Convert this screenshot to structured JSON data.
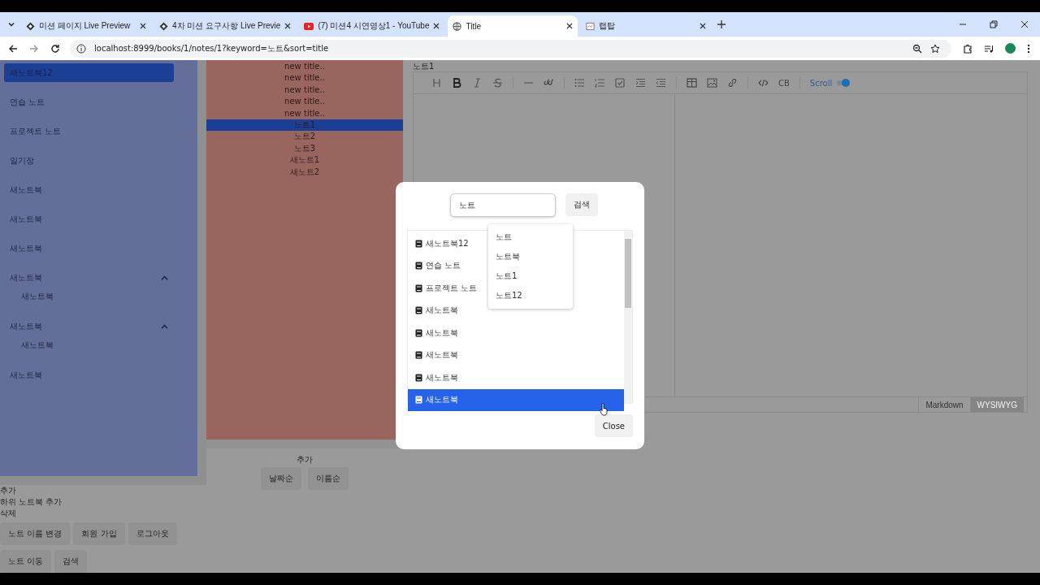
{
  "browser": {
    "tabs": [
      {
        "title": "미션 페이지 Live Preview",
        "selected": false
      },
      {
        "title": "4차 미션 요구사항 Live Previe",
        "selected": false
      },
      {
        "title": "(7) 미션4 시연영상1 - YouTube",
        "selected": false
      },
      {
        "title": "Title",
        "selected": true
      },
      {
        "title": "랩탑",
        "selected": false
      }
    ],
    "url": "localhost:8999/books/1/notes/1?keyword=노트&sort=title"
  },
  "sidebar": {
    "items": [
      {
        "label": "새노트북12",
        "selected": true
      },
      {
        "label": "연습 노트",
        "selected": false
      },
      {
        "label": "프로젝트 노트",
        "selected": false
      },
      {
        "label": "일기장",
        "selected": false
      },
      {
        "label": "새노트북",
        "selected": false
      },
      {
        "label": "새노트북",
        "selected": false
      },
      {
        "label": "새노트북",
        "selected": false
      },
      {
        "label": "새노트북",
        "selected": false,
        "expanded": true,
        "children": [
          {
            "label": "새노트북"
          }
        ]
      },
      {
        "label": "새노트북",
        "selected": false,
        "expanded": true,
        "children": [
          {
            "label": "새노트북"
          }
        ]
      },
      {
        "label": "새노트북",
        "selected": false
      }
    ],
    "links": [
      "추가",
      "하위 노트북 추가",
      "삭제"
    ],
    "buttons": [
      "노트 이름 변경",
      "회원 가입",
      "로그아웃",
      "노트 이동",
      "검색"
    ]
  },
  "notes": {
    "items": [
      {
        "title": "new title..",
        "selected": false
      },
      {
        "title": "new title..",
        "selected": false
      },
      {
        "title": "new title..",
        "selected": false
      },
      {
        "title": "new title..",
        "selected": false
      },
      {
        "title": "new title..",
        "selected": false
      },
      {
        "title": "노트1",
        "selected": true
      },
      {
        "title": "노트2",
        "selected": false
      },
      {
        "title": "노트3",
        "selected": false
      },
      {
        "title": "새노트1",
        "selected": false
      },
      {
        "title": "새노트2",
        "selected": false
      }
    ],
    "add": "추가",
    "sort_buttons": [
      "날짜순",
      "이름순"
    ]
  },
  "editor": {
    "title": "노트1",
    "codeblock": "CB",
    "scroll_label": "Scroll",
    "scroll_sync": true,
    "modes": [
      {
        "label": "Markdown",
        "selected": true
      },
      {
        "label": "WYSIWYG",
        "selected": false
      }
    ]
  },
  "dialog": {
    "search": {
      "value": "노트"
    },
    "search_button": "검색",
    "suggestions": [
      "노트",
      "노트북",
      "노트1",
      "노트12"
    ],
    "results": [
      {
        "label": "새노트북12",
        "selected": false
      },
      {
        "label": "연습 노트",
        "selected": false
      },
      {
        "label": "프로젝트 노트",
        "selected": false
      },
      {
        "label": "새노트북",
        "selected": false
      },
      {
        "label": "새노트북",
        "selected": false
      },
      {
        "label": "새노트북",
        "selected": false
      },
      {
        "label": "새노트북",
        "selected": false
      },
      {
        "label": "새노트북",
        "selected": true
      }
    ],
    "close": "Close"
  }
}
